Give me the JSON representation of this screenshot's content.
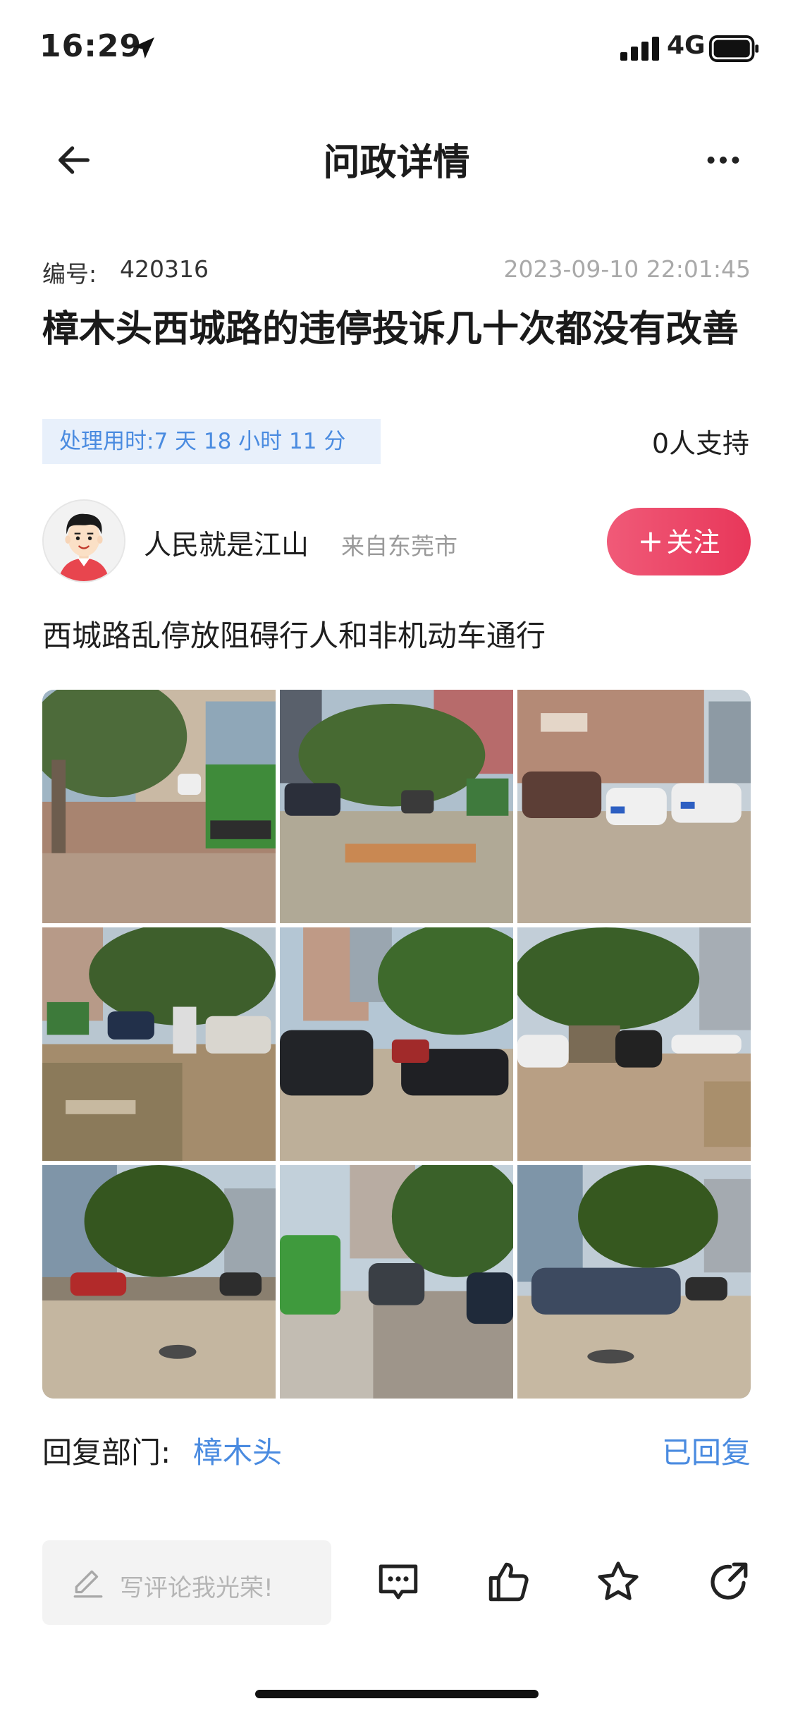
{
  "status_bar": {
    "time": "16:29",
    "network": "4G"
  },
  "header": {
    "title": "问政详情"
  },
  "post": {
    "id_label": "编号:",
    "id_value": "420316",
    "date": "2023-09-10 22:01:45",
    "title": "樟木头西城路的违停投诉几十次都没有改善",
    "processing_time": "处理用时:7 天 18 小时 11 分",
    "support": "0人支持",
    "body": "西城路乱停放阻碍行人和非机动车通行"
  },
  "user": {
    "name": "人民就是江山",
    "from": "来自东莞市",
    "follow_label": "关注"
  },
  "photos": [
    {
      "name": "photo-1"
    },
    {
      "name": "photo-2"
    },
    {
      "name": "photo-3"
    },
    {
      "name": "photo-4"
    },
    {
      "name": "photo-5"
    },
    {
      "name": "photo-6"
    },
    {
      "name": "photo-7"
    },
    {
      "name": "photo-8"
    },
    {
      "name": "photo-9"
    }
  ],
  "reply": {
    "label": "回复部门:",
    "department": "樟木头",
    "status": "已回复"
  },
  "bottom_bar": {
    "comment_placeholder": "写评论我光荣!"
  },
  "icons": [
    "location-icon",
    "signal-icon",
    "battery-icon",
    "back-icon",
    "more-icon",
    "pencil-icon",
    "comment-icon",
    "like-icon",
    "star-icon",
    "share-icon"
  ],
  "colors": {
    "accent_blue": "#4a8be0",
    "follow_red": "#e8375a",
    "badge_bg": "#e8f0fb"
  }
}
